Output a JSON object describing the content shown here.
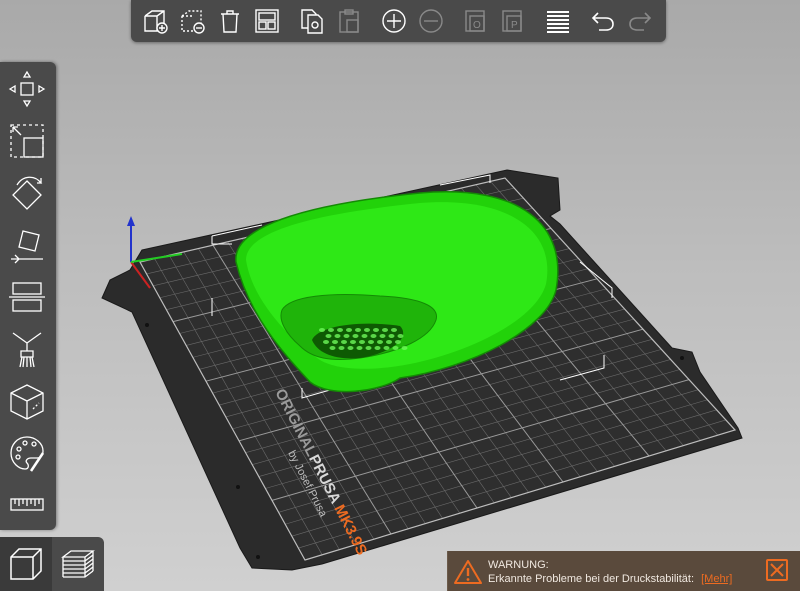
{
  "app": {
    "accent_color": "#ed6b21",
    "model_color": "#22e00a"
  },
  "top_toolbar": {
    "buttons": [
      {
        "name": "add-object",
        "icon": "cube-plus-icon",
        "enabled": true
      },
      {
        "name": "delete",
        "icon": "dashed-cube-minus-icon",
        "enabled": true
      },
      {
        "name": "delete-all",
        "icon": "trash-icon",
        "enabled": true
      },
      {
        "name": "arrange",
        "icon": "arrange-grid-icon",
        "enabled": true
      },
      {
        "name": "copy",
        "icon": "copy-icon",
        "enabled": true
      },
      {
        "name": "paste",
        "icon": "paste-icon",
        "enabled": false
      },
      {
        "name": "add-instance",
        "icon": "circle-plus-icon",
        "enabled": true
      },
      {
        "name": "remove-instance",
        "icon": "circle-minus-icon",
        "enabled": false
      },
      {
        "name": "split-objects",
        "icon": "split-objects-icon",
        "enabled": false
      },
      {
        "name": "split-parts",
        "icon": "split-parts-icon",
        "enabled": false
      },
      {
        "name": "layers-editing",
        "icon": "layers-stack-icon",
        "enabled": true
      },
      {
        "name": "undo",
        "icon": "undo-arrow-icon",
        "enabled": true
      },
      {
        "name": "redo",
        "icon": "redo-arrow-icon",
        "enabled": false
      }
    ]
  },
  "left_toolbar": {
    "tools": [
      {
        "name": "move",
        "icon": "move-arrows-icon"
      },
      {
        "name": "scale",
        "icon": "scale-icon"
      },
      {
        "name": "rotate",
        "icon": "rotate-icon"
      },
      {
        "name": "place-on-face",
        "icon": "place-on-face-icon"
      },
      {
        "name": "cut",
        "icon": "cut-icon"
      },
      {
        "name": "paint-supports",
        "icon": "paint-supports-icon"
      },
      {
        "name": "seam-painting",
        "icon": "seam-cube-icon"
      },
      {
        "name": "mmu-painting",
        "icon": "palette-icon"
      },
      {
        "name": "measure",
        "icon": "ruler-icon"
      }
    ]
  },
  "view_switch": [
    {
      "name": "3d-view",
      "icon": "cube-view-icon",
      "active": true
    },
    {
      "name": "preview",
      "icon": "layers-preview-icon",
      "active": false
    }
  ],
  "bed": {
    "brand": "ORIGINAL",
    "brand_name": "PRUSA",
    "model": "MK3.9S",
    "byline": "by Josef Prusa"
  },
  "notification": {
    "title": "WARNUNG:",
    "text": "Erkannte Probleme bei der Druckstabilität:",
    "link": "[Mehr]"
  }
}
